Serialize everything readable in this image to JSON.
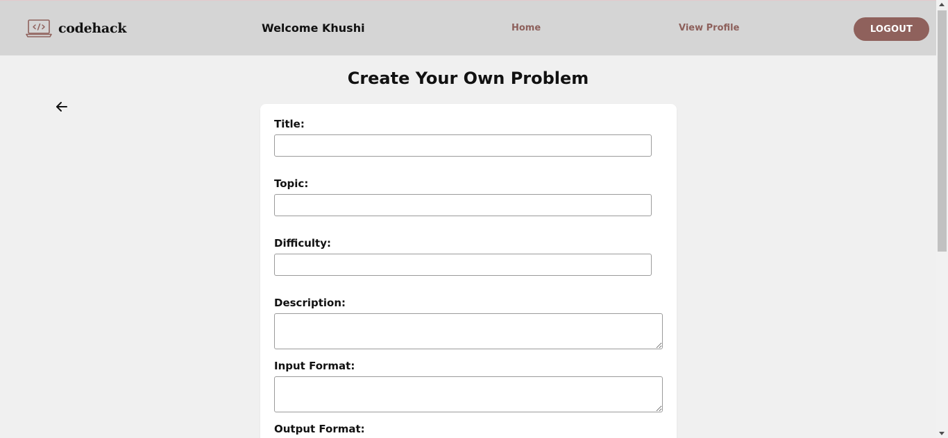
{
  "header": {
    "brand_name": "codehack",
    "brand_icon": "laptop-code-icon",
    "welcome_text": "Welcome Khushi",
    "nav": {
      "home_label": "Home",
      "profile_label": "View Profile"
    },
    "logout_label": "LOGOUT"
  },
  "page": {
    "title": "Create Your Own Problem",
    "back_icon": "arrow-left-icon"
  },
  "form": {
    "title_label": "Title:",
    "title_value": "",
    "topic_label": "Topic:",
    "topic_value": "",
    "difficulty_label": "Difficulty:",
    "difficulty_value": "",
    "description_label": "Description:",
    "description_value": "",
    "input_format_label": "Input Format:",
    "input_format_value": "",
    "output_format_label": "Output Format:"
  },
  "colors": {
    "accent": "#8f615c",
    "nav_link": "#8d605b",
    "header_bg": "#d5d5d5",
    "page_bg": "#f0f0f0",
    "card_bg": "#ffffff"
  }
}
